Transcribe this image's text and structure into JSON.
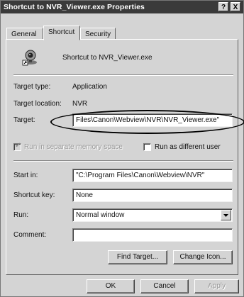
{
  "window": {
    "title": "Shortcut to NVR_Viewer.exe Properties",
    "help_glyph": "?",
    "close_glyph": "X"
  },
  "tabs": [
    {
      "label": "General",
      "active": false
    },
    {
      "label": "Shortcut",
      "active": true
    },
    {
      "label": "Security",
      "active": false
    }
  ],
  "header": {
    "name": "Shortcut to NVR_Viewer.exe",
    "icon": "camera-shortcut-icon"
  },
  "props": {
    "target_type_label": "Target type:",
    "target_type_value": "Application",
    "target_location_label": "Target location:",
    "target_location_value": "NVR",
    "target_label": "Target:",
    "target_value": "Files\\Canon\\Webview\\NVR\\NVR_Viewer.exe\"",
    "run_separate_label": "Run in separate memory space",
    "run_separate_checked": true,
    "run_as_label": "Run as different user",
    "run_as_checked": false,
    "start_in_label": "Start in:",
    "start_in_value": "\"C:\\Program Files\\Canon\\Webview\\NVR\"",
    "shortcut_key_label": "Shortcut key:",
    "shortcut_key_value": "None",
    "run_label": "Run:",
    "run_value": "Normal window",
    "comment_label": "Comment:",
    "comment_value": ""
  },
  "buttons": {
    "find_target": "Find Target...",
    "change_icon": "Change Icon...",
    "ok": "OK",
    "cancel": "Cancel",
    "apply": "Apply"
  },
  "colors": {
    "titlebar": "#3a3a3a",
    "face": "#d4d4d4"
  }
}
